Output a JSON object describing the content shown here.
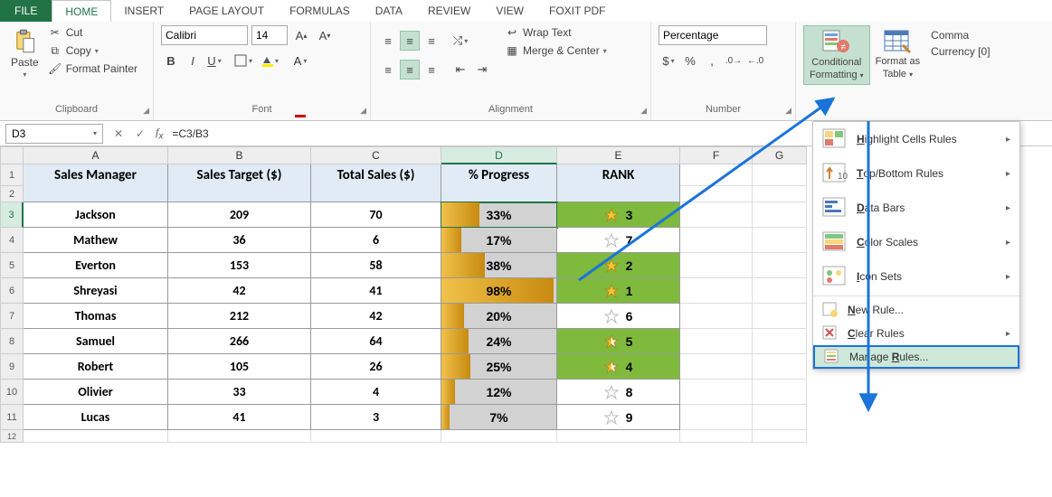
{
  "tabs": {
    "file": "FILE",
    "items": [
      "HOME",
      "INSERT",
      "PAGE LAYOUT",
      "FORMULAS",
      "DATA",
      "REVIEW",
      "VIEW",
      "FOXIT PDF"
    ],
    "active": "HOME"
  },
  "ribbon": {
    "clipboard": {
      "paste": "Paste",
      "cut": "Cut",
      "copy": "Copy",
      "format_painter": "Format Painter",
      "label": "Clipboard"
    },
    "font": {
      "name": "Calibri",
      "size": "14",
      "label": "Font"
    },
    "alignment": {
      "wrap": "Wrap Text",
      "merge": "Merge & Center",
      "label": "Alignment"
    },
    "number": {
      "format": "Percentage",
      "label": "Number"
    },
    "styles": {
      "cond": "Conditional Formatting",
      "cond_line1": "Conditional",
      "cond_line2": "Formatting",
      "fat": "Format as Table",
      "fat_line1": "Format as",
      "fat_line2": "Table",
      "cs1": "Comma",
      "cs2": "Currency [0]"
    }
  },
  "menu": {
    "hl": "Highlight Cells Rules",
    "tb": "Top/Bottom Rules",
    "db": "Data Bars",
    "cs": "Color Scales",
    "is": "Icon Sets",
    "new": "New Rule...",
    "clear": "Clear Rules",
    "manage": "Manage Rules...",
    "ul": {
      "hl": "H",
      "tb": "T",
      "db": "D",
      "cs": "C",
      "is": "I",
      "new": "N",
      "clear": "C",
      "manage": "R"
    }
  },
  "fbar": {
    "name": "D3",
    "formula": "=C3/B3"
  },
  "grid": {
    "cols": [
      "A",
      "B",
      "C",
      "D",
      "E",
      "F",
      "G"
    ],
    "headers": [
      "Sales Manager",
      "Sales Target ($)",
      "Total Sales ($)",
      "% Progress",
      "RANK"
    ],
    "rows": [
      {
        "n": "3",
        "name": "Jackson",
        "target": "209",
        "sales": "70",
        "pct": 33,
        "rank": 3,
        "star": "gold",
        "green": true
      },
      {
        "n": "4",
        "name": "Mathew",
        "target": "36",
        "sales": "6",
        "pct": 17,
        "rank": 7,
        "star": "outline",
        "green": false
      },
      {
        "n": "5",
        "name": "Everton",
        "target": "153",
        "sales": "58",
        "pct": 38,
        "rank": 2,
        "star": "gold",
        "green": true
      },
      {
        "n": "6",
        "name": "Shreyasi",
        "target": "42",
        "sales": "41",
        "pct": 98,
        "rank": 1,
        "star": "gold",
        "green": true
      },
      {
        "n": "7",
        "name": "Thomas",
        "target": "212",
        "sales": "42",
        "pct": 20,
        "rank": 6,
        "star": "outline",
        "green": false
      },
      {
        "n": "8",
        "name": "Samuel",
        "target": "266",
        "sales": "64",
        "pct": 24,
        "rank": 5,
        "star": "half",
        "green": true
      },
      {
        "n": "9",
        "name": "Robert",
        "target": "105",
        "sales": "26",
        "pct": 25,
        "rank": 4,
        "star": "half",
        "green": true
      },
      {
        "n": "10",
        "name": "Olivier",
        "target": "33",
        "sales": "4",
        "pct": 12,
        "rank": 8,
        "star": "outline",
        "green": false
      },
      {
        "n": "11",
        "name": "Lucas",
        "target": "41",
        "sales": "3",
        "pct": 7,
        "rank": 9,
        "star": "outline",
        "green": false
      }
    ]
  },
  "chart_data": {
    "type": "table",
    "title": "",
    "columns": [
      "Sales Manager",
      "Sales Target ($)",
      "Total Sales ($)",
      "% Progress",
      "RANK"
    ],
    "data": [
      [
        "Jackson",
        209,
        70,
        0.33,
        3
      ],
      [
        "Mathew",
        36,
        6,
        0.17,
        7
      ],
      [
        "Everton",
        153,
        58,
        0.38,
        2
      ],
      [
        "Shreyasi",
        42,
        41,
        0.98,
        1
      ],
      [
        "Thomas",
        212,
        42,
        0.2,
        6
      ],
      [
        "Samuel",
        266,
        64,
        0.24,
        5
      ],
      [
        "Robert",
        105,
        26,
        0.25,
        4
      ],
      [
        "Olivier",
        33,
        4,
        0.12,
        8
      ],
      [
        "Lucas",
        41,
        3,
        0.07,
        9
      ]
    ]
  }
}
